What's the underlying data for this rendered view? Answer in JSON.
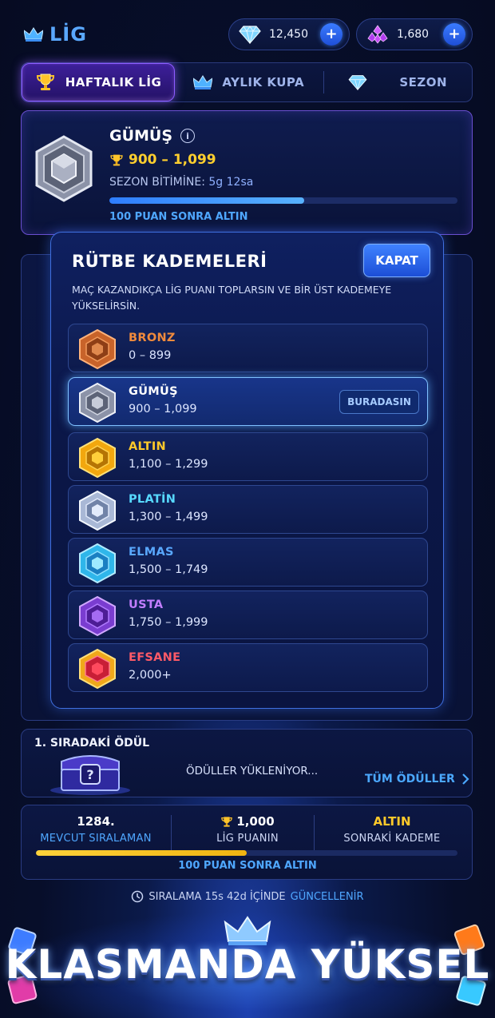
{
  "header": {
    "title": "LİG",
    "gems": "12,450",
    "crystals": "1,680",
    "plus": "+"
  },
  "tabs": [
    {
      "label": "HAFTALIK LİG",
      "icon": "trophy-icon",
      "active": true
    },
    {
      "label": "AYLIK KUPA",
      "icon": "crown-icon",
      "active": false
    },
    {
      "label": "SEZON",
      "icon": "diamond-icon",
      "active": false
    }
  ],
  "league": {
    "name": "GÜMÜŞ",
    "info": "i",
    "range": "900 – 1,099",
    "season_label": "SEZON BİTİMİNE:",
    "season_time": "5g 12sa",
    "progress": 0.56,
    "next": "100 PUAN SONRA ALTIN"
  },
  "modal": {
    "title": "RÜTBE KADEMELERİ",
    "close": "KAPAT",
    "description": "MAÇ KAZANDIKÇA LİG PUANI TOPLARSIN VE BİR ÜST KADEMEYE YÜKSELİRSİN.",
    "here_label": "BURADASIN",
    "tiers": [
      {
        "name": "BRONZ",
        "range": "0 – 899",
        "color": "#f08a3c"
      },
      {
        "name": "GÜMÜŞ",
        "range": "900 – 1,099",
        "color": "#ffffff",
        "current": true
      },
      {
        "name": "ALTIN",
        "range": "1,100 – 1,299",
        "color": "#ffc92a"
      },
      {
        "name": "PLATİN",
        "range": "1,300 – 1,499",
        "color": "#57d9ff"
      },
      {
        "name": "ELMAS",
        "range": "1,500 – 1,749",
        "color": "#59a8ff"
      },
      {
        "name": "USTA",
        "range": "1,750 – 1,999",
        "color": "#c17dff"
      },
      {
        "name": "EFSANE",
        "range": "2,000+",
        "color": "#ff5a67"
      }
    ]
  },
  "reward": {
    "title": "1. SIRADAKİ ÖDÜL",
    "loading": "ÖDÜLLER YÜKLENİYOR...",
    "all": "TÜM ÖDÜLLER"
  },
  "stats": {
    "rank_value": "1284.",
    "rank_label": "MEVCUT SIRALAMAN",
    "points_value": "1,000",
    "points_label": "LİG PUANIN",
    "next_value": "ALTIN",
    "next_label": "SONRAKİ KADEME",
    "progress": 0.5,
    "next_text": "100 PUAN SONRA ALTIN"
  },
  "update": {
    "prefix": "SIRALAMA 15s 42d İÇİNDE",
    "highlight": "GÜNCELLENİR"
  },
  "banner": "KLASMANDA YÜKSEL",
  "colors": {
    "accent_blue": "#4fa7ff",
    "gold": "#ffcf2e",
    "purple": "#8d5cff"
  }
}
